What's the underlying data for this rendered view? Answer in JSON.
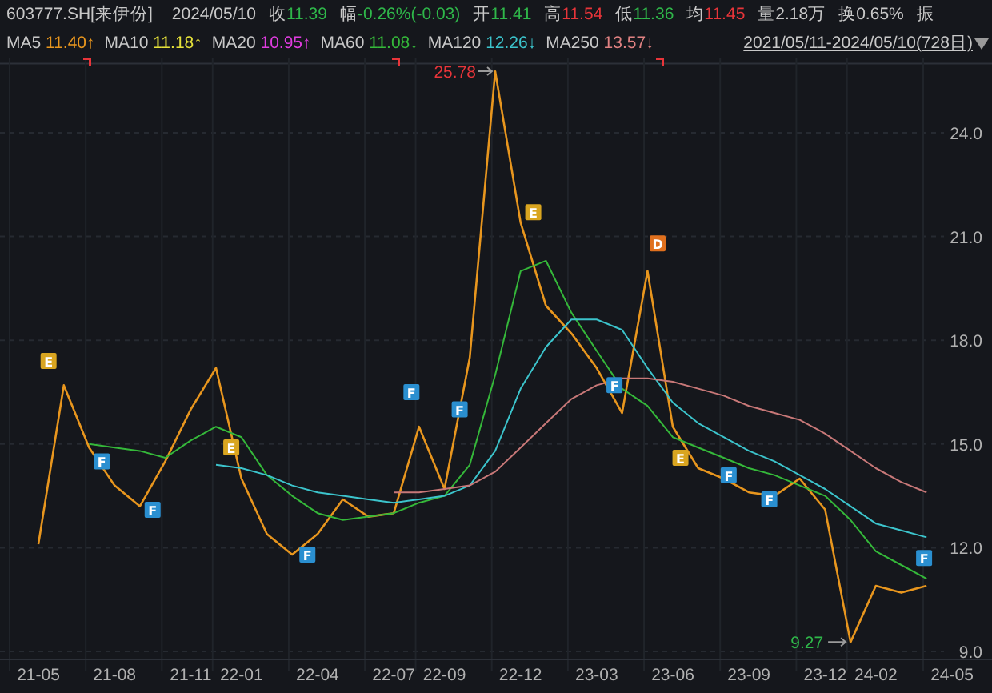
{
  "header": {
    "symbol": "603777.SH[来伊份]",
    "date": "2024/05/10",
    "quotes": [
      {
        "label": "收",
        "value": "11.39",
        "color": "#2fb74a"
      },
      {
        "label": "幅",
        "value": "-0.26%(-0.03)",
        "color": "#2fb74a"
      },
      {
        "label": "开",
        "value": "11.41",
        "color": "#2fb74a"
      },
      {
        "label": "高",
        "value": "11.54",
        "color": "#e8353a"
      },
      {
        "label": "低",
        "value": "11.36",
        "color": "#2fb74a"
      },
      {
        "label": "均",
        "value": "11.45",
        "color": "#e8353a"
      },
      {
        "label": "量",
        "value": "2.18万",
        "color": "#c8c8c8"
      },
      {
        "label": "换",
        "value": "0.65%",
        "color": "#c8c8c8"
      },
      {
        "label": "振"
      }
    ]
  },
  "ma_legend": [
    {
      "label": "MA5",
      "value": "11.40↑",
      "color": "#e8961e"
    },
    {
      "label": "MA10",
      "value": "11.18↑",
      "color": "#e6e23a"
    },
    {
      "label": "MA20",
      "value": "10.95↑",
      "color": "#e03ce0"
    },
    {
      "label": "MA60",
      "value": "11.08↓",
      "color": "#35b83a"
    },
    {
      "label": "MA120",
      "value": "12.26↓",
      "color": "#3cc4cc"
    },
    {
      "label": "MA250",
      "value": "13.57↓",
      "color": "#e08282"
    }
  ],
  "date_range": "2021/05/11-2024/05/10(728日)",
  "signals": [
    {
      "label": "E",
      "color": "#d9a520"
    },
    {
      "label": "F",
      "color": "#2a8fd0"
    },
    {
      "label": "F",
      "color": "#2a8fd0"
    },
    {
      "label": "E",
      "color": "#d9a520"
    },
    {
      "label": "F",
      "color": "#2a8fd0"
    },
    {
      "label": "F",
      "color": "#2a8fd0"
    },
    {
      "label": "F",
      "color": "#2a8fd0"
    },
    {
      "label": "E",
      "color": "#d9a520"
    },
    {
      "label": "F",
      "color": "#2a8fd0"
    },
    {
      "label": "D",
      "color": "#e0701e"
    },
    {
      "label": "E",
      "color": "#d9a520"
    },
    {
      "label": "F",
      "color": "#2a8fd0"
    },
    {
      "label": "F",
      "color": "#2a8fd0"
    },
    {
      "label": "F",
      "color": "#2a8fd0"
    }
  ],
  "chart_data": {
    "type": "line",
    "categories": [
      "21-05",
      null,
      null,
      "21-08",
      null,
      null,
      "21-11",
      null,
      "22-01",
      null,
      null,
      "22-04",
      null,
      null,
      "22-07",
      null,
      "22-09",
      null,
      null,
      "22-12",
      null,
      null,
      "23-03",
      null,
      null,
      "23-06",
      null,
      null,
      "23-09",
      null,
      null,
      "23-12",
      null,
      "24-02",
      null,
      null,
      "24-05"
    ],
    "series": [
      {
        "color": "#e8961e",
        "values": [
          12.1,
          16.7,
          14.9,
          13.8,
          13.2,
          14.5,
          16.0,
          17.2,
          14.0,
          12.4,
          11.8,
          12.4,
          13.4,
          12.9,
          13.0,
          15.5,
          13.7,
          17.5,
          25.78,
          21.4,
          19.0,
          18.2,
          17.2,
          15.9,
          20.0,
          15.5,
          14.3,
          14.0,
          13.6,
          13.5,
          14.0,
          13.1,
          9.27,
          10.9,
          10.7,
          10.9,
          null
        ]
      },
      {
        "color": "#35b83a",
        "values": [
          null,
          null,
          15.0,
          14.9,
          14.8,
          14.6,
          15.1,
          15.5,
          15.2,
          14.1,
          13.5,
          13.0,
          12.8,
          12.9,
          13.0,
          13.3,
          13.5,
          14.4,
          17.0,
          20.0,
          20.3,
          18.8,
          17.7,
          16.6,
          16.1,
          15.2,
          14.9,
          14.6,
          14.3,
          14.1,
          13.8,
          13.5,
          12.8,
          11.9,
          11.5,
          11.1,
          null
        ]
      },
      {
        "color": "#3cc4cc",
        "values": [
          null,
          null,
          null,
          null,
          null,
          null,
          null,
          14.4,
          14.3,
          14.1,
          13.8,
          13.6,
          13.5,
          13.4,
          13.3,
          13.4,
          13.5,
          13.8,
          14.8,
          16.6,
          17.8,
          18.6,
          18.6,
          18.3,
          17.2,
          16.2,
          15.6,
          15.2,
          14.8,
          14.5,
          14.1,
          13.7,
          13.2,
          12.7,
          12.5,
          12.3,
          null
        ]
      },
      {
        "color": "#c87878",
        "values": [
          null,
          null,
          null,
          null,
          null,
          null,
          null,
          null,
          null,
          null,
          null,
          null,
          null,
          null,
          13.6,
          13.6,
          13.7,
          13.8,
          14.2,
          14.9,
          15.6,
          16.3,
          16.7,
          16.9,
          16.9,
          16.8,
          16.6,
          16.4,
          16.1,
          15.9,
          15.7,
          15.3,
          14.8,
          14.3,
          13.9,
          13.6,
          null
        ]
      }
    ],
    "ylim": [
      9,
      26
    ],
    "grid": true,
    "yticks": [
      {
        "value": 9,
        "label": "9.0"
      },
      {
        "value": 12,
        "label": "12.0"
      },
      {
        "value": 15,
        "label": "15.0"
      },
      {
        "value": 18,
        "label": "18.0"
      },
      {
        "value": 21,
        "label": "21.0"
      },
      {
        "value": 24,
        "label": "24.0"
      }
    ],
    "annotations": [
      "25.78",
      "9.27"
    ]
  }
}
